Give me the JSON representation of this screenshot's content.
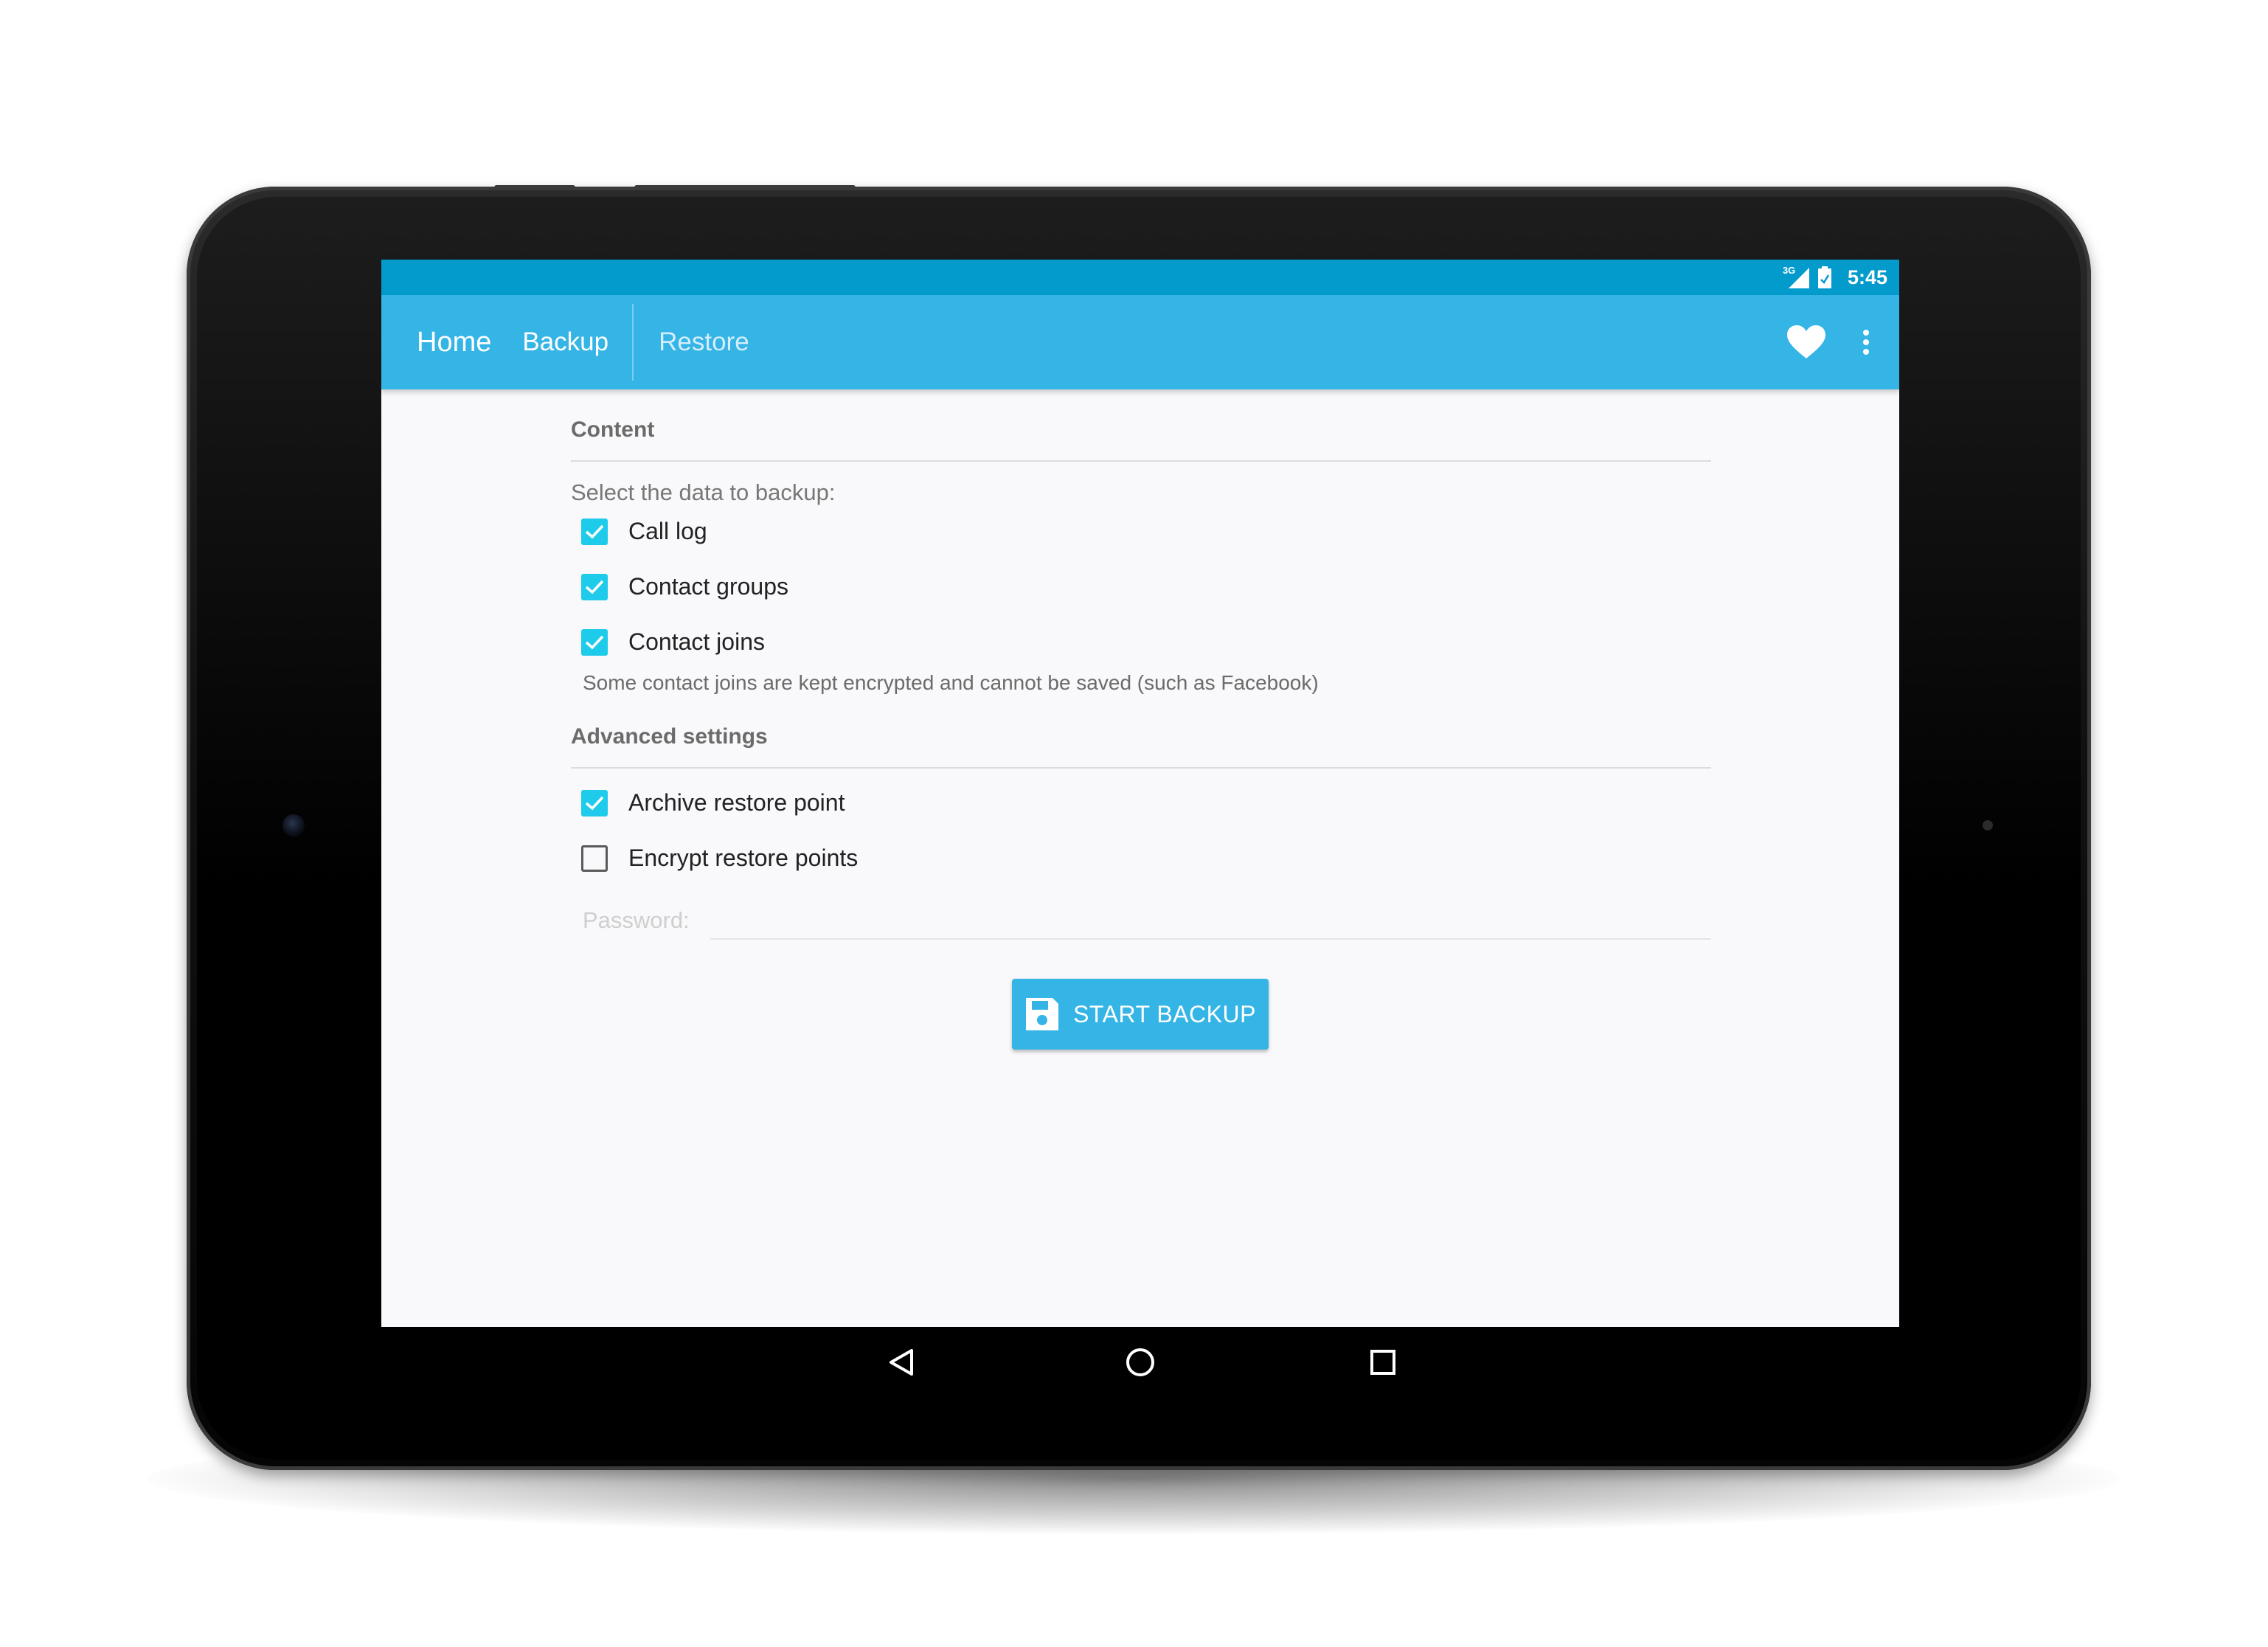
{
  "status_bar": {
    "network": "3G",
    "time": "5:45"
  },
  "app_bar": {
    "title": "Home",
    "tabs": [
      {
        "label": "Backup",
        "active": true
      },
      {
        "label": "Restore",
        "active": false
      }
    ],
    "actions": [
      "heart-icon",
      "more-vert-icon"
    ]
  },
  "content": {
    "section_content": "Content",
    "prompt": "Select the data to backup:",
    "data_options": [
      {
        "label": "Call log",
        "checked": true
      },
      {
        "label": "Contact groups",
        "checked": true
      },
      {
        "label": "Contact joins",
        "checked": true
      }
    ],
    "joins_note": "Some contact joins are kept encrypted and cannot be saved (such as Facebook)",
    "section_advanced": "Advanced settings",
    "advanced_options": [
      {
        "label": "Archive restore point",
        "checked": true
      },
      {
        "label": "Encrypt restore points",
        "checked": false
      }
    ],
    "password_label": "Password:",
    "start_button": "START BACKUP"
  },
  "nav_bar": {
    "buttons": [
      "back-icon",
      "home-icon",
      "recents-icon"
    ]
  },
  "colors": {
    "status_bar": "#039bcc",
    "app_bar": "#35b4e6",
    "checkbox": "#1ecbea",
    "screen_bg": "#f9f8fa"
  }
}
